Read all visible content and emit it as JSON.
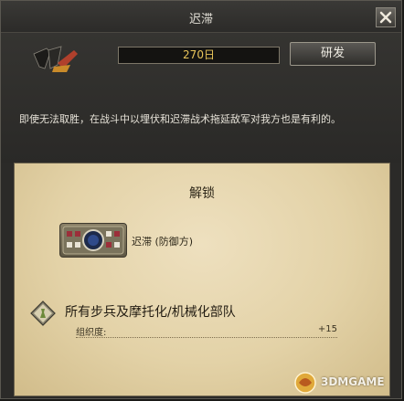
{
  "window": {
    "title": "迟滞"
  },
  "header": {
    "days_value": "270日",
    "research_label": "研发"
  },
  "description": "即使无法取胜，在战斗中以埋伏和迟滞战术拖延敌军对我方也是有利的。",
  "unlock": {
    "title": "解锁",
    "tactic_label": "迟滞 (防御方)",
    "unit_group": "所有步兵及摩托化/机械化部队",
    "stats": [
      {
        "name": "组织度:",
        "value": "+15"
      }
    ]
  },
  "watermark": {
    "text": "3DMGAME"
  },
  "icons": {
    "close": "close-icon",
    "emblem": "division-emblem-icon",
    "tactic": "tactic-card-icon",
    "unit": "unit-diamond-icon",
    "logo": "3dm-logo-icon"
  },
  "colors": {
    "days_text": "#e8c45a",
    "parchment": "#e3d2a7",
    "frame": "#2b2a28"
  }
}
